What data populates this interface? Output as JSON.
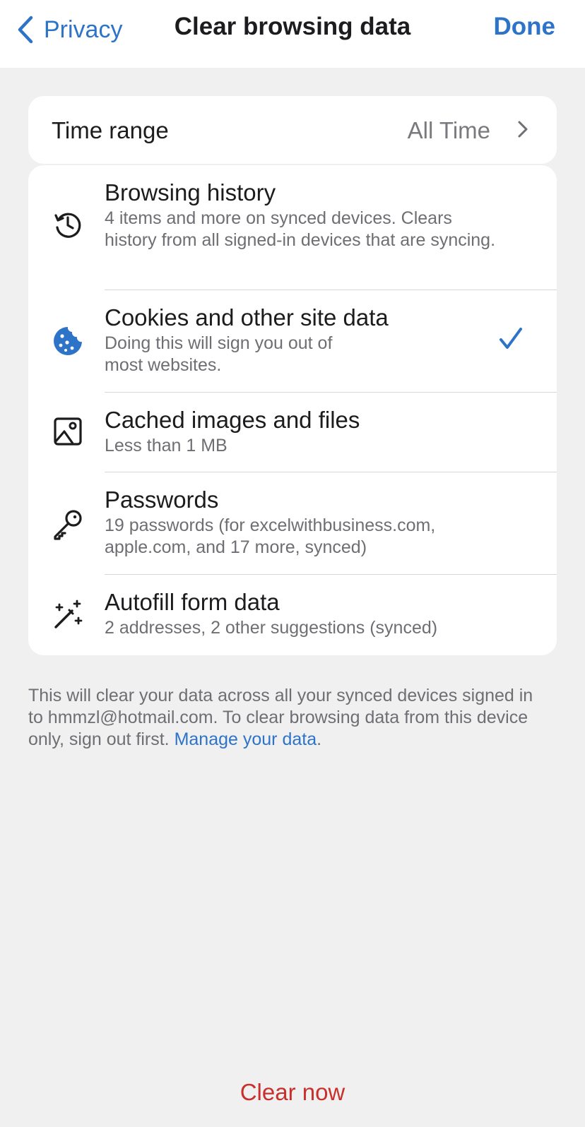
{
  "navbar": {
    "back_label": "Privacy",
    "title": "Clear browsing data",
    "done_label": "Done"
  },
  "time_range": {
    "label": "Time range",
    "value": "All Time"
  },
  "items": [
    {
      "icon": "history-icon",
      "title": "Browsing history",
      "subtitle": "4 items and more on synced devices. Clears history from all signed-in devices that are syncing.",
      "checked": false
    },
    {
      "icon": "cookie-icon",
      "title": "Cookies and other site data",
      "subtitle": "Doing this will sign you out of most websites.",
      "checked": true
    },
    {
      "icon": "image-icon",
      "title": "Cached images and files",
      "subtitle": "Less than 1 MB",
      "checked": false
    },
    {
      "icon": "key-icon",
      "title": "Passwords",
      "subtitle": "19 passwords (for excelwithbusiness.com, apple.com, and 17 more, synced)",
      "checked": false
    },
    {
      "icon": "magic-wand-icon",
      "title": "Autofill form data",
      "subtitle": "2 addresses, 2 other suggestions (synced)",
      "checked": false
    }
  ],
  "footer": {
    "text": "This will clear your data across all your synced devices signed in to hmmzl@hotmail.com. To clear browsing data from this device only, sign out first. ",
    "link": "Manage your data",
    "end": "."
  },
  "clear_button": "Clear now",
  "colors": {
    "accent": "#2d74c9",
    "destructive": "#c9302c",
    "background": "#f0f0f0",
    "secondary_text": "#6e6e73"
  }
}
